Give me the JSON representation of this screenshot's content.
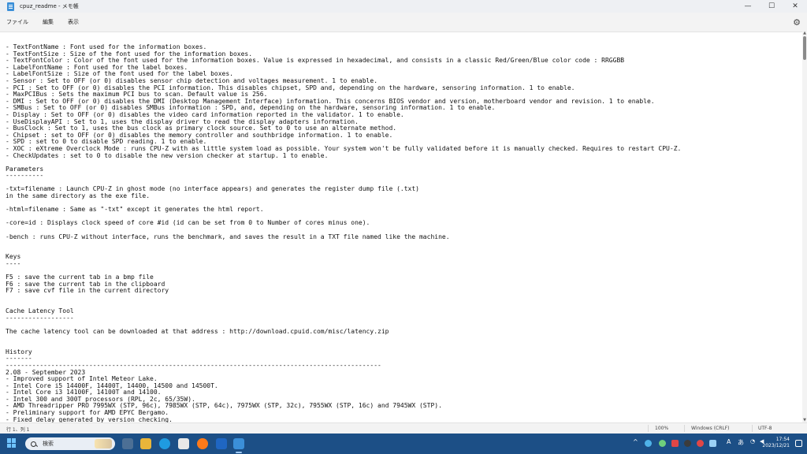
{
  "window": {
    "title": "cpuz_readme - メモ帳",
    "minimize": "—",
    "maximize": "☐",
    "close": "✕"
  },
  "menu": {
    "file": "ファイル",
    "edit": "編集",
    "view": "表示",
    "settings_icon": "gear-icon"
  },
  "editor": {
    "lines": [
      "- TextFontName : Font used for the information boxes.",
      "- TextFontSize : Size of the font used for the information boxes.",
      "- TextFontColor : Color of the font used for the information boxes. Value is expressed in hexadecimal, and consists in a classic Red/Green/Blue color code : RRGGBB",
      "- LabelFontName : Font used for the label boxes.",
      "- LabelFontSize : Size of the font used for the label boxes.",
      "- Sensor : Set to OFF (or 0) disables sensor chip detection and voltages measurement. 1 to enable.",
      "- PCI : Set to OFF (or 0) disables the PCI information. This disables chipset, SPD and, depending on the hardware, sensoring information. 1 to enable.",
      "- MaxPCIBus : Sets the maximum PCI bus to scan. Default value is 256.",
      "- DMI : Set to OFF (or 0) disables the DMI (Desktop Management Interface) information. This concerns BIOS vendor and version, motherboard vendor and revision. 1 to enable.",
      "- SMBus : Set to OFF (or 0) disables SMBus information : SPD, and, depending on the hardware, sensoring information. 1 to enable.",
      "- Display : Set to OFF (or 0) disables the video card information reported in the validator. 1 to enable.",
      "- UseDisplayAPI : Set to 1, uses the display driver to read the display adapters information.",
      "- BusClock : Set to 1, uses the bus clock as primary clock source. Set to 0 to use an alternate method.",
      "- Chipset : set to OFF (or 0) disables the memory controller and southbridge information. 1 to enable.",
      "- SPD : set to 0 to disable SPD reading. 1 to enable.",
      "- XOC : eXtreme Overclock Mode : runs CPU-Z with as little system load as possible. Your system won't be fully validated before it is manually checked. Requires to restart CPU-Z.",
      "- CheckUpdates : set to 0 to disable the new version checker at startup. 1 to enable.",
      "",
      "Parameters",
      "----------",
      "",
      "-txt=filename : Launch CPU-Z in ghost mode (no interface appears) and generates the register dump file (.txt)",
      "in the same directory as the exe file.",
      "",
      "-html=filename : Same as \"-txt\" except it generates the html report.",
      "",
      "-core=id : Displays clock speed of core #id (id can be set from 0 to Number of cores minus one).",
      "",
      "-bench : runs CPU-Z without interface, runs the benchmark, and saves the result in a TXT file named like the machine.",
      "",
      "",
      "Keys",
      "----",
      "",
      "F5 : save the current tab in a bmp file",
      "F6 : save the current tab in the clipboard",
      "F7 : save cvf file in the current directory",
      "",
      "",
      "Cache Latency Tool",
      "------------------",
      "",
      "The cache latency tool can be downloaded at that address : http://download.cpuid.com/misc/latency.zip",
      "",
      "",
      "History",
      "-------",
      "---------------------------------------------------------------------------------------------------",
      "2.08 - September 2023",
      "- Improved support of Intel Meteor Lake.",
      "- Intel Core i5 14400F, 14400T, 14400, 14500 and 14500T.",
      "- Intel Core i3 14100F, 14100T and 14100.",
      "- Intel 300 and 300T processors (RPL, 2c, 65/35W).",
      "- AMD Threadripper PRO 7995WX (STP, 96c), 7985WX (STP, 64c), 7975WX (STP, 32c), 7955WX (STP, 16c) and 7945WX (STP).",
      "- Preliminary support for AMD EPYC Bergamo.",
      "- Fixed delay generated by version checking."
    ]
  },
  "status": {
    "position": "行 1、列 1",
    "zoom": "100%",
    "line_ending": "Windows (CRLF)",
    "encoding": "UTF-8"
  },
  "taskbar": {
    "search_label": "検索",
    "tray_chevron": "^",
    "tray_ime_a": "A",
    "tray_ime_kana": "あ",
    "time": "17:54",
    "date": "2023/12/21"
  }
}
